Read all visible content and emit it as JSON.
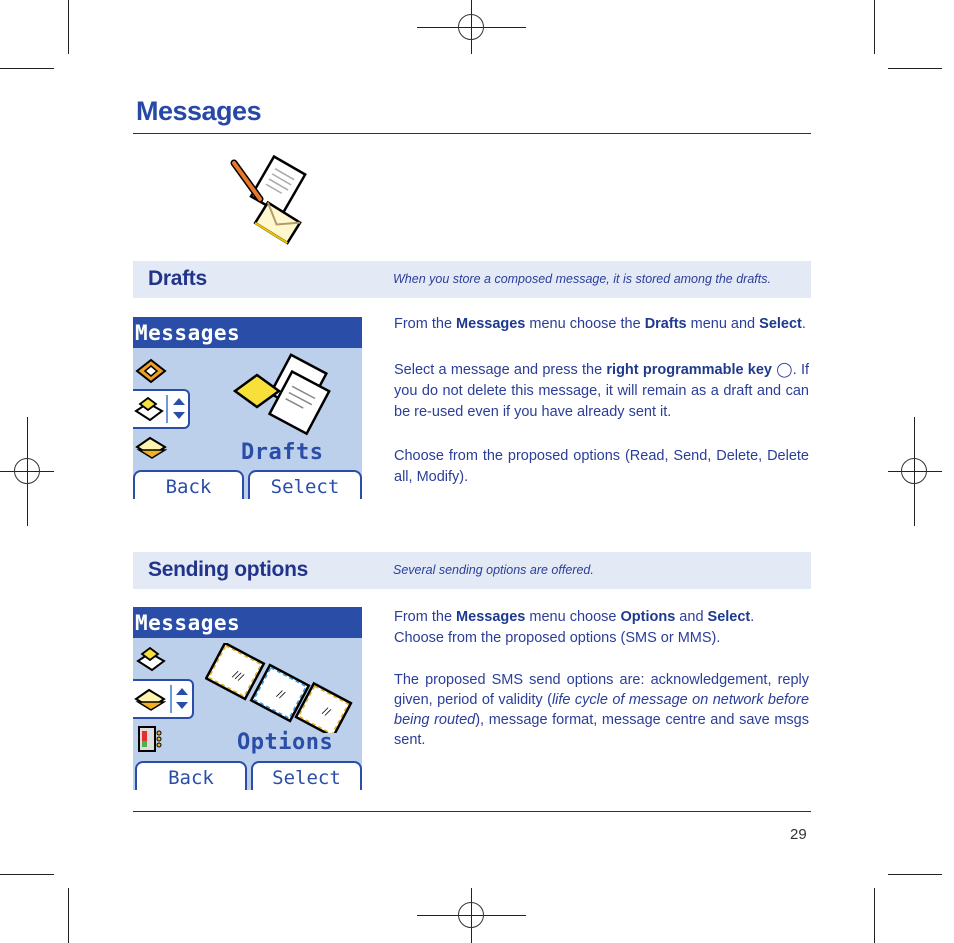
{
  "page": {
    "title": "Messages",
    "page_number": "29"
  },
  "sections": [
    {
      "title": "Drafts",
      "note": "When you store a composed message, it is stored among the drafts.",
      "screen": {
        "header": "Messages",
        "label": "Drafts",
        "softkeys": [
          "Back",
          "Select"
        ],
        "icons": [
          "voicemail-icon",
          "drafts-icon",
          "outbox-icon"
        ]
      },
      "paragraphs": [
        [
          {
            "t": "From the "
          },
          {
            "t": "Messages",
            "b": true
          },
          {
            "t": " menu choose the "
          },
          {
            "t": "Drafts",
            "b": true
          },
          {
            "t": " menu and "
          },
          {
            "t": "Select",
            "b": true
          },
          {
            "t": "."
          }
        ],
        [
          {
            "t": "Select a message and press the "
          },
          {
            "t": "right programmable key",
            "b": true
          },
          {
            "t": " ◯. If you do not delete this message, it will remain as a draft and can be re-used even if you have already sent it."
          }
        ],
        [
          {
            "t": "Choose from the proposed options (Read, Send, Delete, Delete all, Modify)."
          }
        ]
      ]
    },
    {
      "title": "Sending options",
      "note": "Several sending options are offered.",
      "screen": {
        "header": "Messages",
        "label": "Options",
        "softkeys": [
          "Back",
          "Select"
        ],
        "icons": [
          "drafts-icon",
          "outbox-icon",
          "memory-icon"
        ]
      },
      "paragraphs": [
        [
          {
            "t": "From the "
          },
          {
            "t": "Messages",
            "b": true
          },
          {
            "t": " menu choose "
          },
          {
            "t": "Options",
            "b": true
          },
          {
            "t": " and "
          },
          {
            "t": "Select",
            "b": true
          },
          {
            "t": "."
          }
        ],
        [
          {
            "t": "Choose from the proposed options (SMS or MMS)."
          }
        ],
        [
          {
            "t": "The proposed SMS send options are: acknowledgement, reply given, period of validity ("
          },
          {
            "t": "life cycle of message on network before being routed",
            "i": true
          },
          {
            "t": "), message format, message centre and save msgs sent."
          }
        ]
      ]
    }
  ]
}
